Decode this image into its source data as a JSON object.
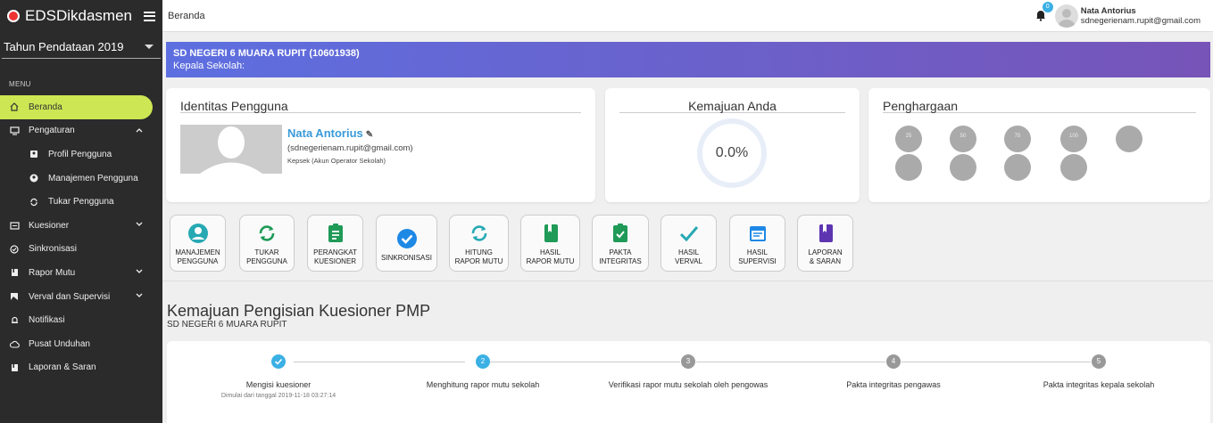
{
  "app": {
    "title": "EDSDikdasmen"
  },
  "sidebar": {
    "year": "Tahun Pendataan 2019",
    "menu_label": "MENU",
    "items": [
      {
        "label": "Beranda"
      },
      {
        "label": "Pengaturan"
      },
      {
        "label": "Profil Pengguna"
      },
      {
        "label": "Manajemen Pengguna"
      },
      {
        "label": "Tukar Pengguna"
      },
      {
        "label": "Kuesioner"
      },
      {
        "label": "Sinkronisasi"
      },
      {
        "label": "Rapor Mutu"
      },
      {
        "label": "Verval dan Supervisi"
      },
      {
        "label": "Notifikasi"
      },
      {
        "label": "Pusat Unduhan"
      },
      {
        "label": "Laporan & Saran"
      }
    ]
  },
  "topbar": {
    "breadcrumb": "Beranda",
    "notif_count": "0",
    "user_name": "Nata Antorius",
    "user_email": "sdnegerienam.rupit@gmail.com"
  },
  "banner": {
    "school": "SD NEGERI 6 MUARA RUPIT (10601938)",
    "kepsek": "Kepala Sekolah:"
  },
  "identity": {
    "title": "Identitas Pengguna",
    "name": "Nata Antorius",
    "email": "(sdnegerienam.rupit@gmail.com)",
    "role": "Kepsek (Akun Operator Sekolah)"
  },
  "progress_card": {
    "title": "Kemajuan Anda",
    "value": "0.0%"
  },
  "awards": {
    "title": "Penghargaan",
    "items": [
      {
        "label": "25"
      },
      {
        "label": "50"
      },
      {
        "label": "75"
      },
      {
        "label": "100"
      },
      {
        "label": ""
      },
      {
        "label": ""
      },
      {
        "label": ""
      },
      {
        "label": ""
      },
      {
        "label": ""
      }
    ]
  },
  "actions": [
    {
      "label1": "MANAJEMEN",
      "label2": "PENGGUNA",
      "icon": "account-circle-icon",
      "color": "#26a9b3"
    },
    {
      "label1": "TUKAR",
      "label2": "PENGGUNA",
      "icon": "sync-icon",
      "color": "#1f9a57"
    },
    {
      "label1": "PERANGKAT",
      "label2": "KUESIONER",
      "icon": "clipboard-list-icon",
      "color": "#1f9a57"
    },
    {
      "label1": "SINKRONISASI",
      "label2": "",
      "icon": "check-circle-icon",
      "color": "#1e88e5"
    },
    {
      "label1": "HITUNG",
      "label2": "RAPOR MUTU",
      "icon": "sync-icon",
      "color": "#26a9b3"
    },
    {
      "label1": "HASIL",
      "label2": "RAPOR MUTU",
      "icon": "book-icon",
      "color": "#1f9a57"
    },
    {
      "label1": "PAKTA",
      "label2": "INTEGRITAS",
      "icon": "clipboard-check-icon",
      "color": "#1f9a57"
    },
    {
      "label1": "HASIL",
      "label2": "VERVAL",
      "icon": "check-icon",
      "color": "#26a9b3"
    },
    {
      "label1": "HASIL",
      "label2": "SUPERVISI",
      "icon": "calendar-icon",
      "color": "#1e88e5"
    },
    {
      "label1": "LAPORAN",
      "label2": "& SARAN",
      "icon": "book-icon",
      "color": "#5e35b1"
    }
  ],
  "progress_section": {
    "title": "Kemajuan Pengisian Kuesioner PMP",
    "subtitle": "SD NEGERI 6 MUARA RUPIT",
    "steps": [
      {
        "num": "",
        "label": "Mengisi kuesioner",
        "note": "Dimulai dari tanggal 2019-11-18 03:27:14",
        "state": "done"
      },
      {
        "num": "2",
        "label": "Menghitung rapor mutu sekolah",
        "note": "",
        "state": "current"
      },
      {
        "num": "3",
        "label": "Verifikasi rapor mutu sekolah oleh pengowas",
        "note": "",
        "state": "todo"
      },
      {
        "num": "4",
        "label": "Pakta integritas pengawas",
        "note": "",
        "state": "todo"
      },
      {
        "num": "5",
        "label": "Pakta integritas kepala sekolah",
        "note": "",
        "state": "todo"
      }
    ]
  }
}
